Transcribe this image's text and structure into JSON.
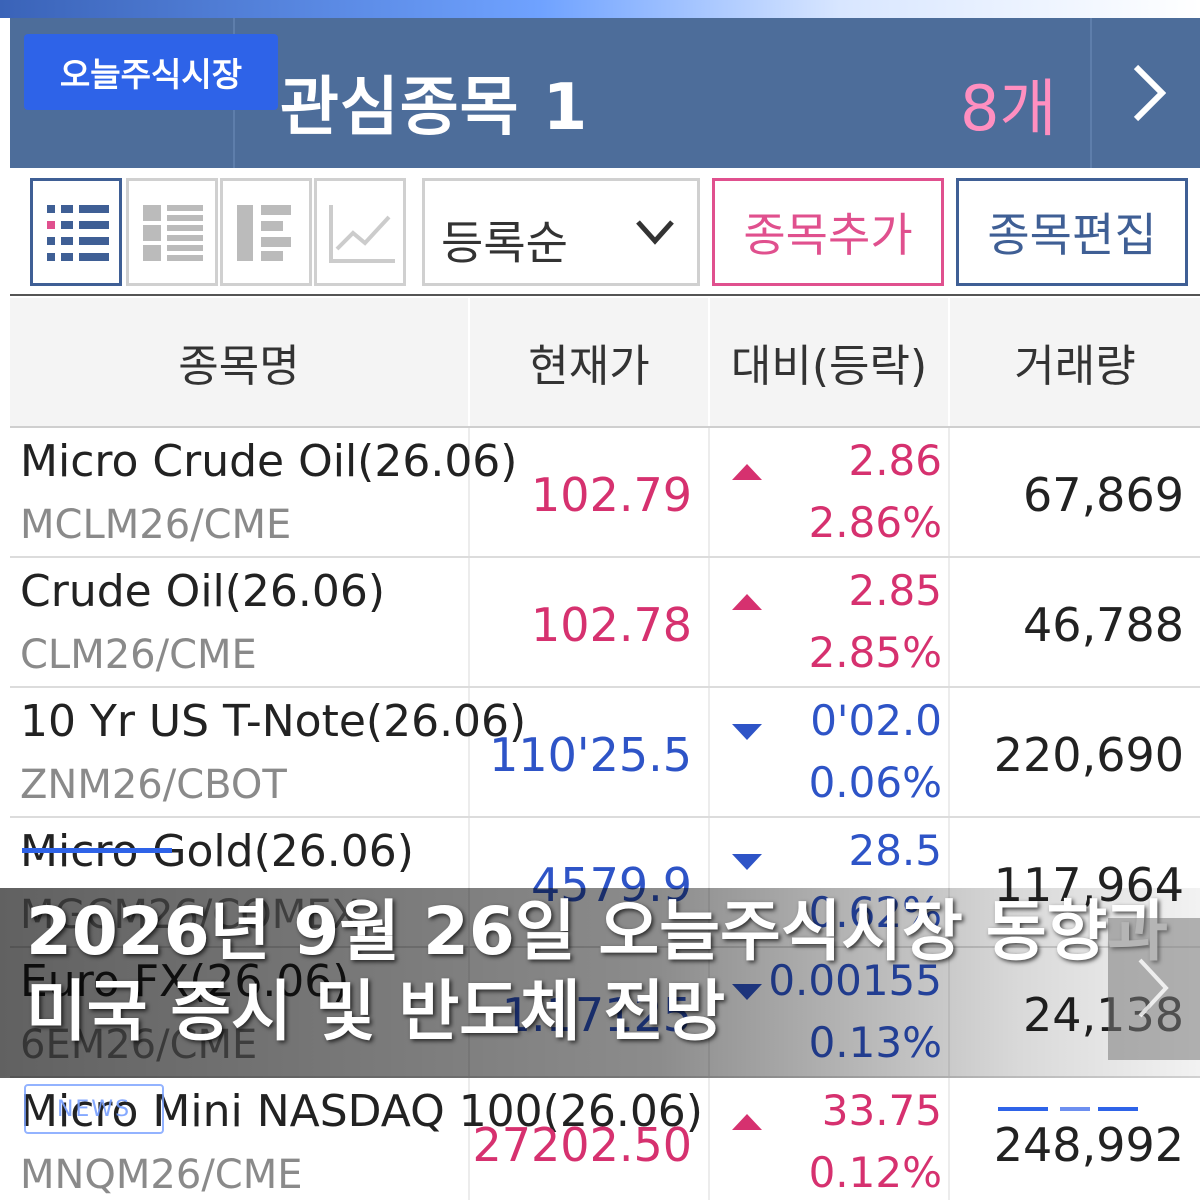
{
  "overlay": {
    "brand_badge": "오늘주식시장",
    "caption_line1": "2026년 9월 26일 오늘주식시장 동향과",
    "caption_line2": "미국 증시 및 반도체 전망",
    "news_badge": "NEWS"
  },
  "header": {
    "title": "관심종목 1",
    "count": "8개"
  },
  "toolbar": {
    "sort_label": "등록순",
    "add_label": "종목추가",
    "edit_label": "종목편집"
  },
  "table": {
    "headers": [
      "종목명",
      "현재가",
      "대비(등락)",
      "거래량"
    ],
    "rows": [
      {
        "name": "Micro Crude Oil(26.06)",
        "code": "MCLM26/CME",
        "price": "102.79",
        "change": "2.86",
        "pct": "2.86%",
        "volume": "67,869",
        "dir": "up"
      },
      {
        "name": "Crude Oil(26.06)",
        "code": "CLM26/CME",
        "price": "102.78",
        "change": "2.85",
        "pct": "2.85%",
        "volume": "46,788",
        "dir": "up"
      },
      {
        "name": "10 Yr US T-Note(26.06)",
        "code": "ZNM26/CBOT",
        "price": "110'25.5",
        "change": "0'02.0",
        "pct": "0.06%",
        "volume": "220,690",
        "dir": "down"
      },
      {
        "name": "Micro Gold(26.06)",
        "code": "MGCM26/COMEX",
        "price": "4579.9",
        "change": "28.5",
        "pct": "0.62%",
        "volume": "117,964",
        "dir": "down"
      },
      {
        "name": "Euro FX(26.06)",
        "code": "6EM26/CME",
        "price": "1.17125",
        "change": "0.00155",
        "pct": "0.13%",
        "volume": "24,138",
        "dir": "down"
      },
      {
        "name": "Micro Mini NASDAQ 100(26.06)",
        "code": "MNQM26/CME",
        "price": "27202.50",
        "change": "33.75",
        "pct": "0.12%",
        "volume": "248,992",
        "dir": "up"
      }
    ]
  },
  "colors": {
    "header_bg": "#4d6d9a",
    "up": "#d6316f",
    "down": "#2e54c7",
    "accent": "#2e63e8"
  }
}
